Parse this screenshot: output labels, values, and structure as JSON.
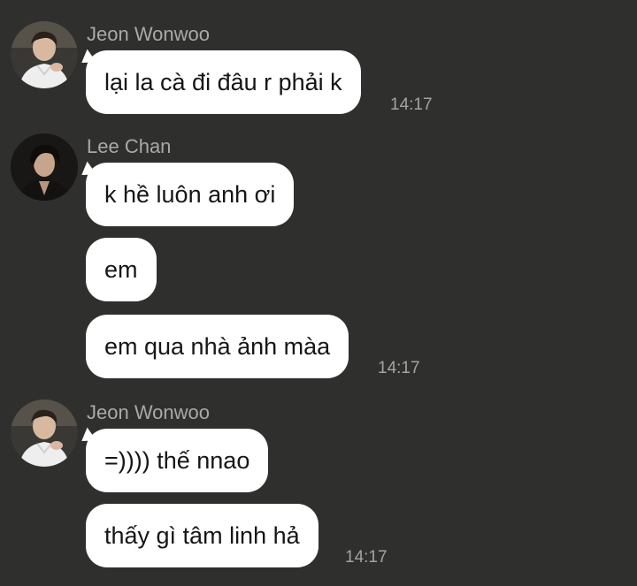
{
  "groups": [
    {
      "sender": "Jeon Wonwoo",
      "messages": [
        "lại la cà đi đâu r phải k"
      ],
      "time": "14:17"
    },
    {
      "sender": "Lee Chan",
      "messages": [
        "k hề luôn anh ơi",
        "em",
        "em qua nhà ảnh màa"
      ],
      "time": "14:17"
    },
    {
      "sender": "Jeon Wonwoo",
      "messages": [
        "=)))) thế nnao",
        "thấy gì tâm linh hả"
      ],
      "time": "14:17"
    }
  ],
  "colors": {
    "background": "#2f302e",
    "bubble": "#ffffff",
    "sender_text": "#a9aaa6",
    "time_text": "#a3a4a0"
  }
}
